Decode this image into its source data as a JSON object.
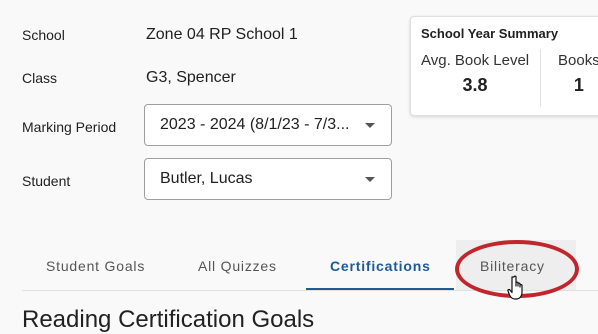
{
  "filters": {
    "school_label": "School",
    "school_value": "Zone 04 RP School 1",
    "class_label": "Class",
    "class_value": "G3, Spencer",
    "marking_period_label": "Marking Period",
    "marking_period_value": "2023 - 2024 (8/1/23 - 7/3...",
    "student_label": "Student",
    "student_value": "Butler, Lucas"
  },
  "summary": {
    "title": "School Year Summary",
    "avg_book_level_label": "Avg. Book Level",
    "avg_book_level_value": "3.8",
    "books_label": "Books",
    "books_value": "1"
  },
  "tabs": [
    {
      "label": "Student Goals",
      "active": false
    },
    {
      "label": "All Quizzes",
      "active": false
    },
    {
      "label": "Certifications",
      "active": true
    },
    {
      "label": "Biliteracy",
      "active": false
    }
  ],
  "section_heading": "Reading Certification Goals",
  "colors": {
    "accent": "#1f5a97",
    "highlight_ring": "#c0262c"
  }
}
